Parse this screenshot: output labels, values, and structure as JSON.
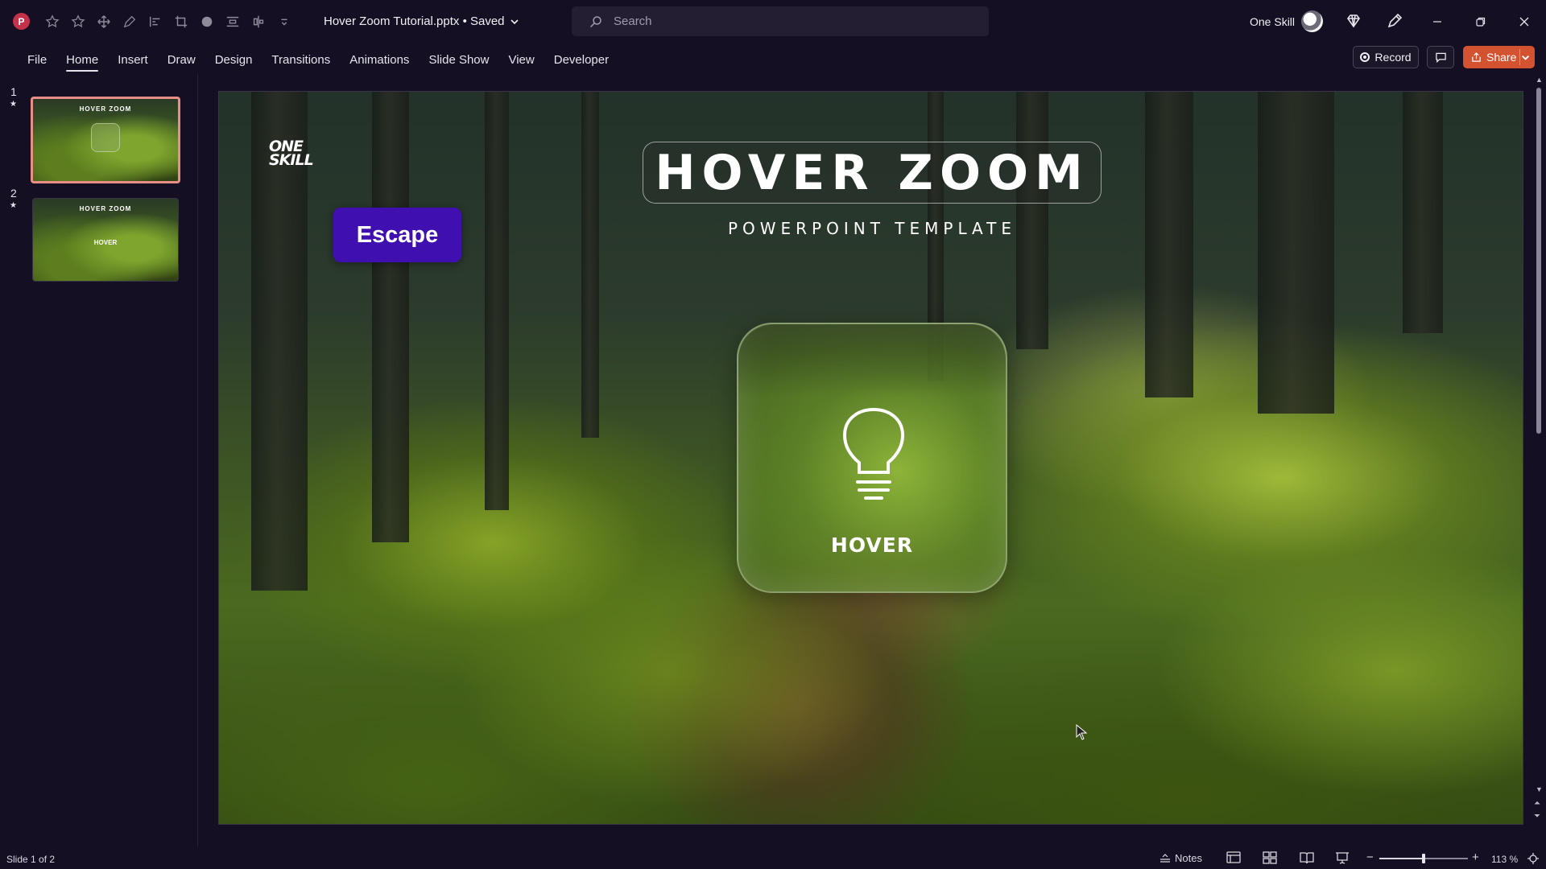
{
  "titlebar": {
    "doc_title": "Hover Zoom Tutorial.pptx • Saved",
    "search_placeholder": "Search",
    "user_name": "One Skill"
  },
  "ribbon": {
    "tabs": [
      "File",
      "Home",
      "Insert",
      "Draw",
      "Design",
      "Transitions",
      "Animations",
      "Slide Show",
      "View",
      "Developer"
    ],
    "active_tab": "Home",
    "record_label": "Record",
    "share_label": "Share"
  },
  "thumbnails": [
    {
      "number": "1",
      "title": "HOVER ZOOM",
      "selected": true
    },
    {
      "number": "2",
      "title": "HOVER ZOOM",
      "label": "HOVER",
      "selected": false
    }
  ],
  "slide": {
    "logo_line1": "ONE",
    "logo_line2": "SKILL",
    "escape_label": "Escape",
    "title": "HOVER ZOOM",
    "subtitle": "POWERPOINT TEMPLATE",
    "card_label": "HOVER"
  },
  "statusbar": {
    "slide_count": "Slide 1 of 2",
    "notes_label": "Notes",
    "zoom_level": "113 %",
    "zoom_fraction": 0.5
  },
  "colors": {
    "background": "#140f22",
    "accent_share": "#d35230",
    "escape_badge": "#3f0fb0",
    "thumb_selected_border": "#e78e86"
  }
}
